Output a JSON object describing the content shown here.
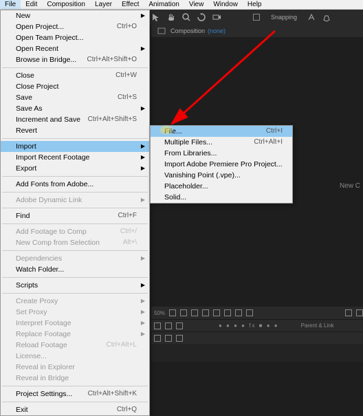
{
  "menubar": [
    "File",
    "Edit",
    "Composition",
    "Layer",
    "Effect",
    "Animation",
    "View",
    "Window",
    "Help"
  ],
  "toolbar": {
    "snapping": "Snapping"
  },
  "composition": {
    "label": "Composition",
    "none": "(none)"
  },
  "new_comp": "New C",
  "file_menu": {
    "new": "New",
    "open_project": {
      "label": "Open Project...",
      "shortcut": "Ctrl+O"
    },
    "open_team": "Open Team Project...",
    "open_recent": "Open Recent",
    "browse_bridge": {
      "label": "Browse in Bridge...",
      "shortcut": "Ctrl+Alt+Shift+O"
    },
    "close": {
      "label": "Close",
      "shortcut": "Ctrl+W"
    },
    "close_project": "Close Project",
    "save": {
      "label": "Save",
      "shortcut": "Ctrl+S"
    },
    "save_as": "Save As",
    "increment_save": {
      "label": "Increment and Save",
      "shortcut": "Ctrl+Alt+Shift+S"
    },
    "revert": "Revert",
    "import": "Import",
    "import_recent": "Import Recent Footage",
    "export": "Export",
    "add_fonts": "Add Fonts from Adobe...",
    "dynamic_link": "Adobe Dynamic Link",
    "find": {
      "label": "Find",
      "shortcut": "Ctrl+F"
    },
    "add_footage": {
      "label": "Add Footage to Comp",
      "shortcut": "Ctrl+/"
    },
    "new_comp_sel": {
      "label": "New Comp from Selection",
      "shortcut": "Alt+\\"
    },
    "dependencies": "Dependencies",
    "watch_folder": "Watch Folder...",
    "scripts": "Scripts",
    "create_proxy": "Create Proxy",
    "set_proxy": "Set Proxy",
    "interpret": "Interpret Footage",
    "replace": "Replace Footage",
    "reload": {
      "label": "Reload Footage",
      "shortcut": "Ctrl+Alt+L"
    },
    "license": "License...",
    "reveal_explorer": "Reveal in Explorer",
    "reveal_bridge": "Reveal in Bridge",
    "project_settings": {
      "label": "Project Settings...",
      "shortcut": "Ctrl+Alt+Shift+K"
    },
    "exit": {
      "label": "Exit",
      "shortcut": "Ctrl+Q"
    }
  },
  "import_submenu": {
    "file": {
      "label": "File...",
      "shortcut": "Ctrl+I"
    },
    "multiple": {
      "label": "Multiple Files...",
      "shortcut": "Ctrl+Alt+I"
    },
    "libraries": "From Libraries...",
    "premiere": "Import Adobe Premiere Pro Project...",
    "vanishing": "Vanishing Point (.vpe)...",
    "placeholder": "Placeholder...",
    "solid": "Solid..."
  },
  "bottom": {
    "zoom": "50%",
    "parent": "Parent & Link"
  }
}
